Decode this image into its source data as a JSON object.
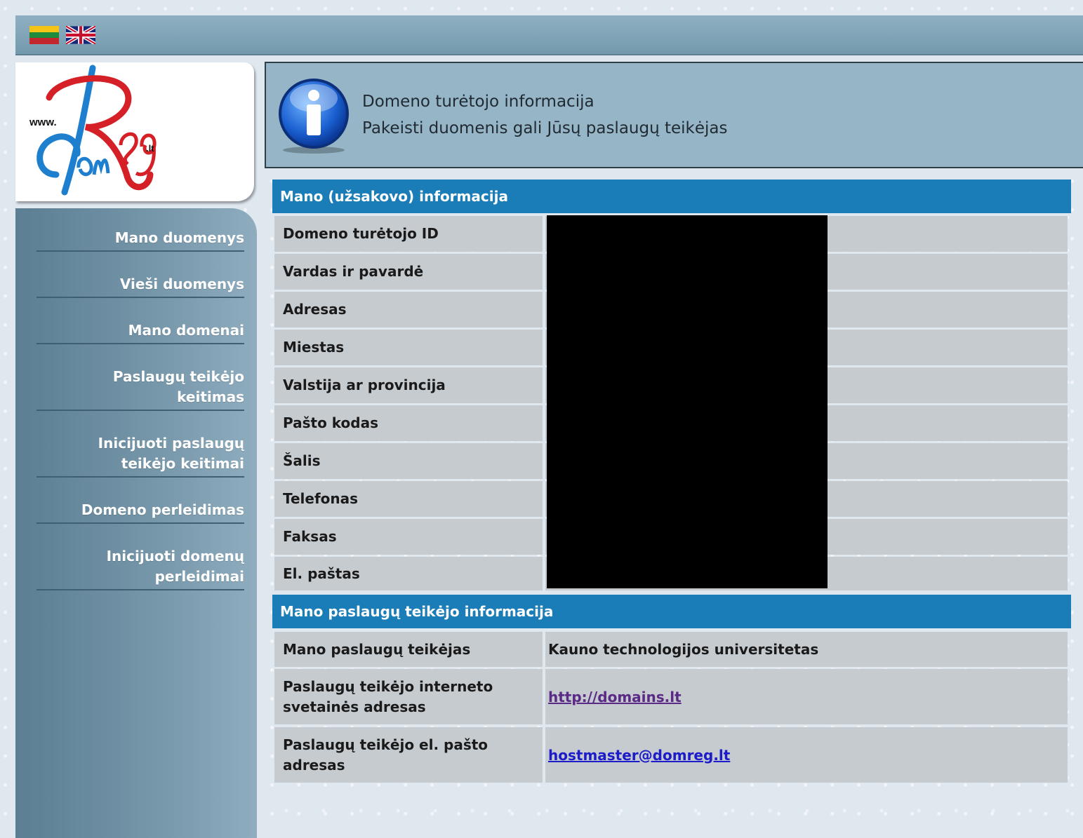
{
  "languages": [
    {
      "name": "Lithuanian",
      "icon": "lithuania-flag-icon"
    },
    {
      "name": "English",
      "icon": "uk-flag-icon"
    }
  ],
  "logo": {
    "text_www": "www.",
    "text_lt": ".lt"
  },
  "sidebar": {
    "items": [
      {
        "lines": [
          "Mano duomenys"
        ]
      },
      {
        "lines": [
          "Vieši duomenys"
        ]
      },
      {
        "lines": [
          "Mano domenai"
        ]
      },
      {
        "lines": [
          "Paslaugų teikėjo",
          "keitimas"
        ]
      },
      {
        "lines": [
          "Inicijuoti paslaugų",
          "teikėjo keitimai"
        ]
      },
      {
        "lines": [
          "Domeno perleidimas"
        ]
      },
      {
        "lines": [
          "Inicijuoti domenų",
          "perleidimai"
        ]
      }
    ]
  },
  "info": {
    "line1": "Domeno turėtojo informacija",
    "line2": "Pakeisti duomenis gali Jūsų paslaugų teikėjas"
  },
  "my_info": {
    "header": "Mano (užsakovo) informacija",
    "rows": [
      {
        "label": "Domeno turėtojo ID",
        "value": ""
      },
      {
        "label": "Vardas ir pavardė",
        "value": ""
      },
      {
        "label": "Adresas",
        "value": ""
      },
      {
        "label": "Miestas",
        "value": ""
      },
      {
        "label": "Valstija ar provincija",
        "value": ""
      },
      {
        "label": "Pašto kodas",
        "value": ""
      },
      {
        "label": "Šalis",
        "value": ""
      },
      {
        "label": "Telefonas",
        "value": ""
      },
      {
        "label": "Faksas",
        "value": ""
      },
      {
        "label": "El. paštas",
        "value": ""
      }
    ]
  },
  "provider_info": {
    "header": "Mano paslaugų teikėjo informacija",
    "rows": [
      {
        "label": "Mano paslaugų teikėjas",
        "value": "Kauno technologijos universitetas"
      },
      {
        "label": "Paslaugų teikėjo interneto svetainės adresas",
        "value": "http://domains.lt"
      },
      {
        "label": "Paslaugų teikėjo el. pašto adresas",
        "value": "hostmaster@domreg.lt"
      }
    ]
  },
  "colors": {
    "table_header": "#1b7db8",
    "cell_bg": "#c6cbcf",
    "sidebar": "#6f90a4",
    "link": "#1c1cc8",
    "link_visited": "#5b2a86"
  }
}
